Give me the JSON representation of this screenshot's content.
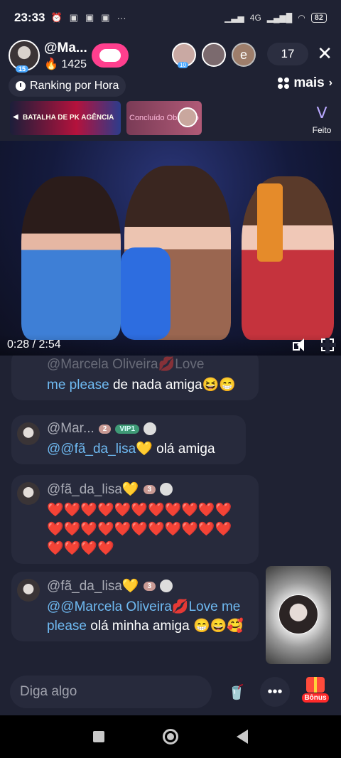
{
  "status_bar": {
    "time": "23:33",
    "network": "4G",
    "battery": "82"
  },
  "host": {
    "name": "@Ma...",
    "level": "15",
    "points": "1425"
  },
  "viewers": {
    "avatar3_letter": "e",
    "avatar1_level": "10",
    "count": "17"
  },
  "ranking": {
    "label": "Ranking por Hora"
  },
  "more": {
    "label": "mais"
  },
  "banners": [
    {
      "text": "BATALHA DE PK AGÊNCIA"
    },
    {
      "text": "Concluído Obrigado"
    }
  ],
  "feito": {
    "label": "Feito"
  },
  "video": {
    "time": "0:28 / 2:54"
  },
  "messages": [
    {
      "user": "@Marcela Oliveira💋Love",
      "text_mention": "me please",
      "text": " de nada amiga😆😁"
    },
    {
      "user": "@Mar...",
      "level": "2",
      "vip": "VIP1",
      "text_mention": "@@fã_da_lisa💛",
      "text": " olá amiga"
    },
    {
      "user": "@fã_da_lisa💛",
      "level": "3",
      "text": "❤️❤️❤️❤️❤️❤️❤️❤️❤️❤️❤️❤️❤️❤️❤️❤️❤️❤️❤️❤️❤️❤️❤️❤️❤️❤️"
    },
    {
      "user": "@fã_da_lisa💛",
      "level": "3",
      "text_mention": "@@Marcela Oliveira💋Love me please",
      "text": " olá minha amiga 😁😄🥰"
    }
  ],
  "input": {
    "placeholder": "Diga algo"
  },
  "bonus": {
    "label": "Bônus"
  },
  "colors": {
    "accent_pink": "#ff3f8e",
    "mention_blue": "#6fbaf2",
    "bubble": "#272a3c"
  }
}
